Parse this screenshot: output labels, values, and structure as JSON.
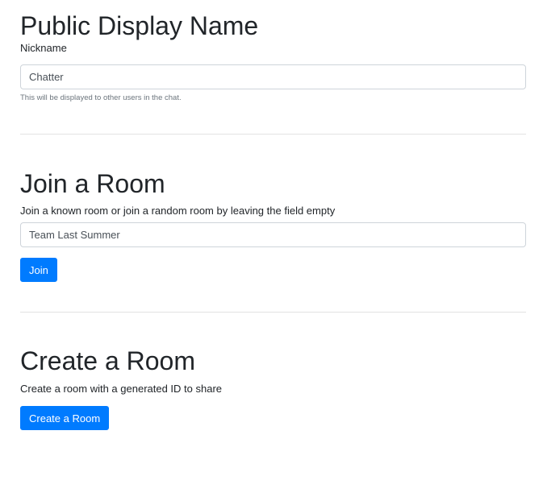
{
  "display_name_section": {
    "heading": "Public Display Name",
    "nickname_label": "Nickname",
    "nickname_value": "Chatter",
    "help_text": "This will be displayed to other users in the chat."
  },
  "join_section": {
    "heading": "Join a Room",
    "description": "Join a known room or join a random room by leaving the field empty",
    "room_value": "Team Last Summer",
    "join_label": "Join"
  },
  "create_section": {
    "heading": "Create a Room",
    "description": "Create a room with a generated ID to share",
    "create_label": "Create a Room"
  },
  "colors": {
    "primary": "#007bff",
    "text": "#212529",
    "muted": "#6c757d",
    "border": "#ced4da"
  }
}
